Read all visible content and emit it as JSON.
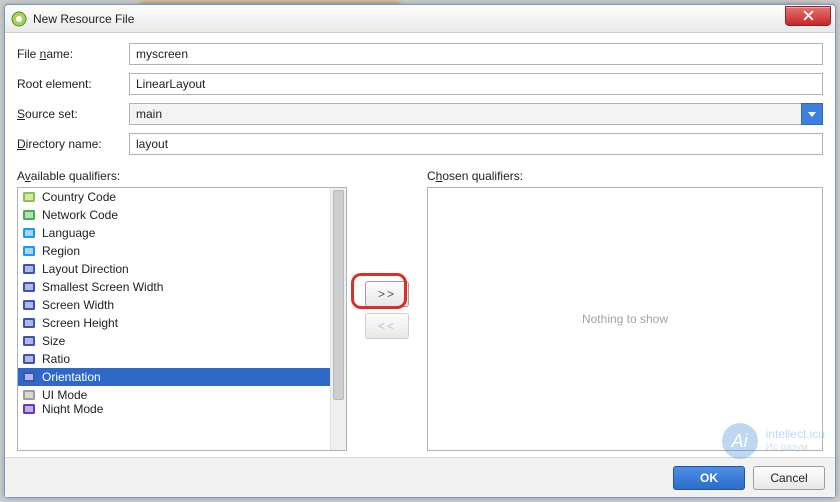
{
  "window": {
    "title": "New Resource File",
    "close_tooltip": "Close"
  },
  "form": {
    "file_name_label_pre": "File ",
    "file_name_label_u": "n",
    "file_name_label_post": "ame:",
    "file_name_value": "myscreen",
    "root_element_label": "Root element:",
    "root_element_value": "LinearLayout",
    "source_set_label_u": "S",
    "source_set_label_post": "ource set:",
    "source_set_value": "main",
    "directory_label_pre": "",
    "directory_label_u": "D",
    "directory_label_post": "irectory name:",
    "directory_value": "layout"
  },
  "qualifiers": {
    "available_label_pre": "A",
    "available_label_u": "v",
    "available_label_post": "ailable qualifiers:",
    "chosen_label_pre": "C",
    "chosen_label_u": "h",
    "chosen_label_post": "osen qualifiers:",
    "empty_text": "Nothing to show",
    "items": [
      {
        "label": "Country Code",
        "icon_color": "#8bc34a"
      },
      {
        "label": "Network Code",
        "icon_color": "#4caf50"
      },
      {
        "label": "Language",
        "icon_color": "#2196f3"
      },
      {
        "label": "Region",
        "icon_color": "#2196f3"
      },
      {
        "label": "Layout Direction",
        "icon_color": "#3f51b5"
      },
      {
        "label": "Smallest Screen Width",
        "icon_color": "#3f51b5"
      },
      {
        "label": "Screen Width",
        "icon_color": "#3f51b5"
      },
      {
        "label": "Screen Height",
        "icon_color": "#3f51b5"
      },
      {
        "label": "Size",
        "icon_color": "#3f51b5"
      },
      {
        "label": "Ratio",
        "icon_color": "#3f51b5"
      },
      {
        "label": "Orientation",
        "icon_color": "#3f51b5",
        "selected": true
      },
      {
        "label": "UI Mode",
        "icon_color": "#9e9e9e"
      },
      {
        "label": "Night Mode",
        "icon_color": "#673ab7",
        "truncated": true
      }
    ],
    "add_button": ">>",
    "remove_button": "<<"
  },
  "footer": {
    "ok": "OK",
    "cancel": "Cancel"
  },
  "watermark": {
    "title": "intellect.icu",
    "subtitle": "Ис                          разум"
  }
}
